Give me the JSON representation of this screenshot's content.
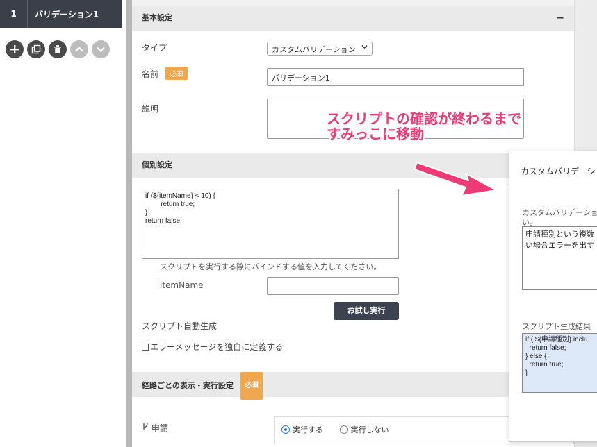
{
  "left_panel": {
    "number": "1",
    "name": "バリデーション1",
    "icons": [
      "plus-icon",
      "copy-icon",
      "trash-icon",
      "up-icon",
      "down-icon"
    ]
  },
  "basic": {
    "header": "基本設定",
    "collapse": "−",
    "type_label": "タイプ",
    "type_value": "カスタムバリデーション",
    "name_label": "名前",
    "required": "必須",
    "name_value": "バリデーション1",
    "desc_label": "説明"
  },
  "individual": {
    "header": "個別設定",
    "code": "if (${itemName} < 10) {\n        return true;\n}\nreturn false;",
    "hint": "スクリプトを実行する際にバインドする値を入力してください。",
    "item_label": "itemName",
    "run_button": "お試し実行",
    "auto_gen": "スクリプト自動生成",
    "custom_error": "エラーメッセージを独自に定義する"
  },
  "route": {
    "header": "経路ごとの表示・実行設定",
    "required": "必須",
    "row_label": "申請",
    "opt_run": "実行する",
    "opt_norun": "実行しない"
  },
  "popup": {
    "title": "カスタムバリデーション",
    "section_label": "カスタムバリデーション",
    "section_label_wrap": "い。",
    "text_line1": "申請種別という複数",
    "text_line2": "い場合エラーを出す",
    "result_label": "スクリプト生成結果",
    "result_code": "if (!${申請種別}.inclu\n  return false;\n} else {\n  return true;\n}"
  },
  "annotation": {
    "line1": "スクリプトの確認が終わるまで",
    "line2": "すみっこに移動"
  },
  "colors": {
    "annotation": "#f03a78",
    "required_badge": "#f0a84e",
    "dark": "#3a3f4a"
  }
}
